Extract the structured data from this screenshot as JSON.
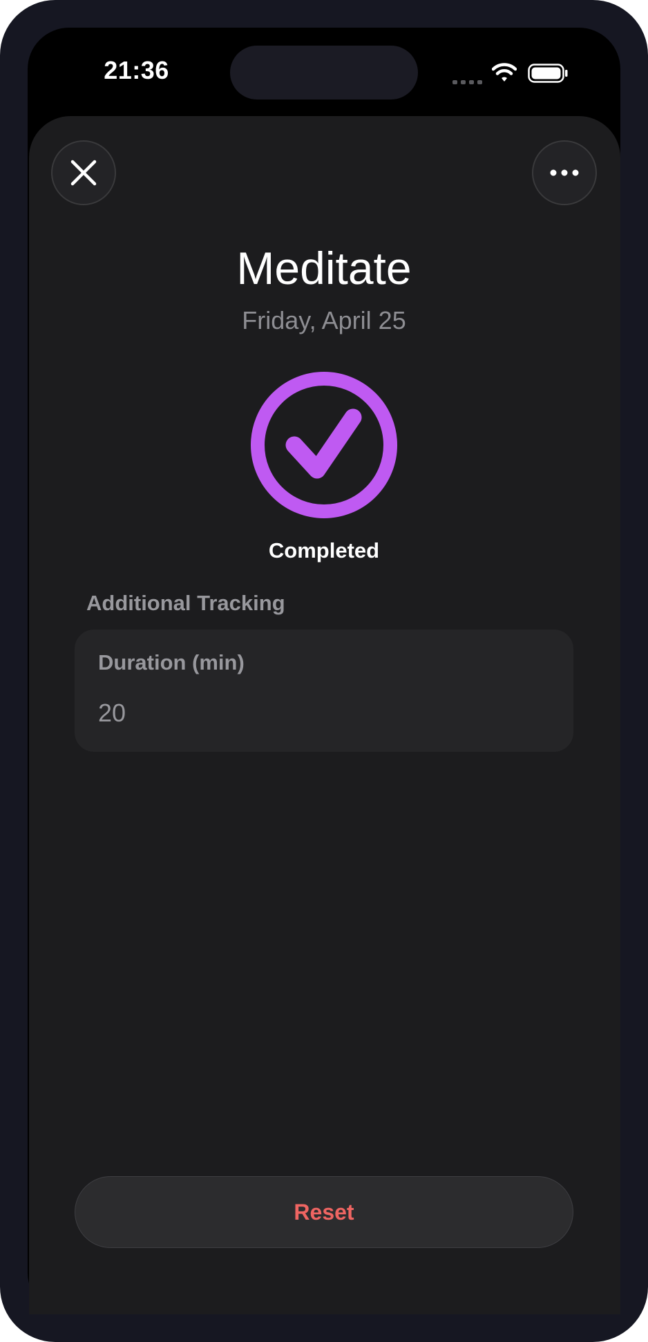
{
  "status_bar": {
    "time": "21:36",
    "icons": [
      "signal-icon",
      "wifi-icon",
      "battery-icon"
    ]
  },
  "toolbar": {
    "close_icon": "close-icon",
    "more_icon": "more-icon"
  },
  "habit": {
    "title": "Meditate",
    "date": "Friday, April 25",
    "status_icon": "checkmark-circle-icon",
    "status": "Completed"
  },
  "tracking": {
    "section_title": "Additional Tracking",
    "fields": [
      {
        "label": "Duration (min)",
        "value": "20"
      }
    ]
  },
  "actions": {
    "reset_label": "Reset"
  },
  "colors": {
    "accent": "#bf5af2",
    "destructive": "#ef6562",
    "background": "#1c1c1e",
    "card": "#252527"
  }
}
